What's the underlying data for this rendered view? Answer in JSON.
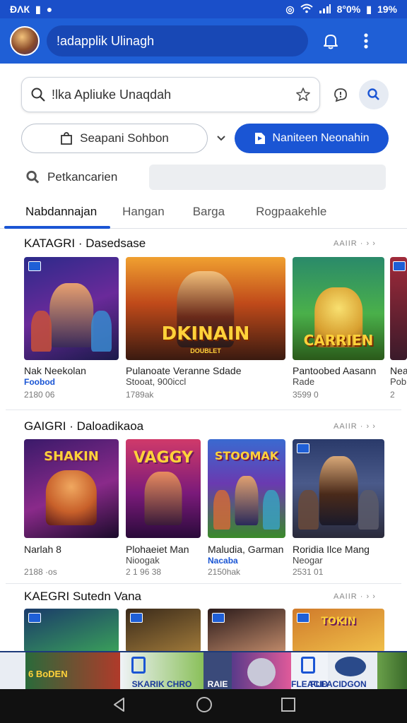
{
  "status_bar": {
    "time": "ĐΛК",
    "battery": "8°0%",
    "signal_text": "19%"
  },
  "app_bar": {
    "title": "!adapplik Ulinagh"
  },
  "search": {
    "value": "!lka Apliuke Unaqdah"
  },
  "buttons": {
    "secondary_label": "Seapani Sohbon",
    "primary_label": "Naniteen Neonahin"
  },
  "filter": {
    "label": "Petkancarien"
  },
  "tabs": [
    {
      "label": "Nabdannajan"
    },
    {
      "label": "Hangan"
    },
    {
      "label": "Barga"
    },
    {
      "label": "Rogpaakehle"
    }
  ],
  "sections": [
    {
      "title": "KATAGRI · Dasedsase",
      "more": "AAIIR · › ›",
      "cards": [
        {
          "title": "Nak Neekolan",
          "subtitle": "Foobod",
          "meta": "2180 06"
        },
        {
          "title": "Pulanoate Veranne Sdade",
          "subtitle": "Stooat, 900iccl",
          "meta": "1789ak"
        },
        {
          "title": "Pantoobed Aasann",
          "subtitle": "Rade",
          "meta": "3599 0"
        },
        {
          "title": "Nea",
          "subtitle": "Pob",
          "meta": "2"
        }
      ]
    },
    {
      "title": "GAIGRI · Daloadikaoa",
      "more": "AAIIR · › ›",
      "cards": [
        {
          "title": "Narlah 8",
          "subtitle": "",
          "meta": "2188 ·os"
        },
        {
          "title": "Plohaeiet Man",
          "subtitle": "Nioogak",
          "meta": "2 1 96 38"
        },
        {
          "title": "Maludia, Garman",
          "subtitle": "Nacaba",
          "meta": "2150hak"
        },
        {
          "title": "Roridia Ilce Mang",
          "subtitle": "Neogar",
          "meta": "2531 01"
        }
      ]
    },
    {
      "title": "KAEGRI Sutedn Vana",
      "more": "AAIIR · › ›"
    }
  ],
  "thumb_text": {
    "dokinain": "DKINAIN",
    "dokinain_sub": "DOUBLET",
    "carrien": "CARRIEN",
    "vaggy": "VAGGY",
    "shakin": "SHAKIN",
    "stoomak": "STOOMAK",
    "tokin": "TOKIN"
  },
  "ad_banner": {
    "tiles": [
      "6 BoDEN",
      "SKARIK CHRO",
      "RAIE",
      "",
      "FLEACIDGON",
      ""
    ]
  },
  "nav": {
    "back": "back",
    "home": "home",
    "recents": "recents"
  },
  "colors": {
    "brand_blue": "#1f5fd6",
    "primary_button": "#1a55d4",
    "status_bar": "#1a4fc9"
  }
}
